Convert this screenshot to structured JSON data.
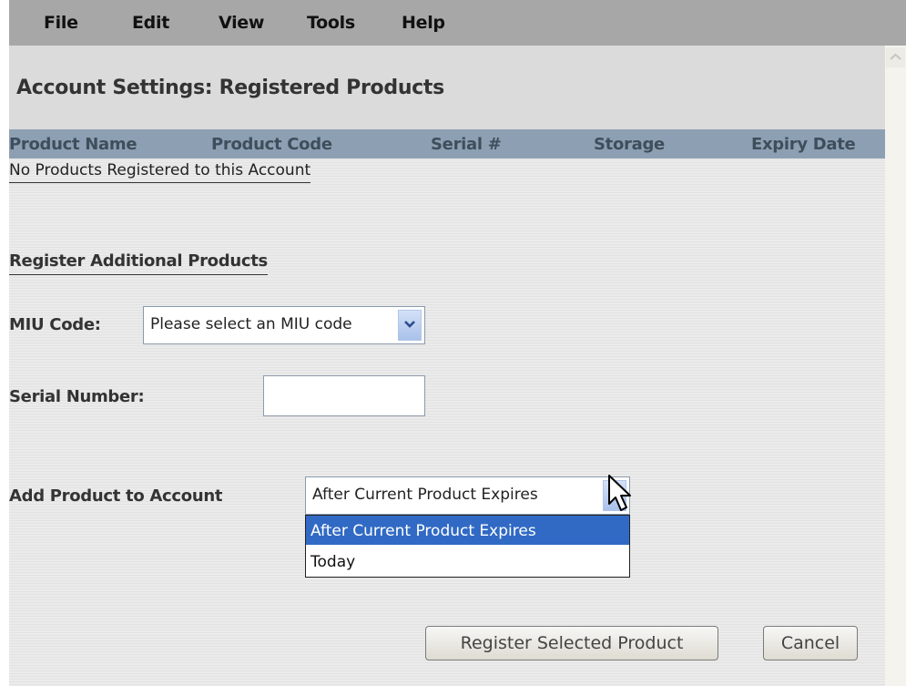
{
  "menu": [
    "File",
    "Edit",
    "View",
    "Tools",
    "Help"
  ],
  "page_title": "Account Settings: Registered Products",
  "table": {
    "columns": [
      "Product Name",
      "Product Code",
      "Serial #",
      "Storage",
      "Expiry Date"
    ],
    "empty_message": "No Products Registered to this Account"
  },
  "register_section": {
    "title": "Register Additional Products",
    "miu_label": "MIU Code:",
    "miu_value": "Please select an MIU code",
    "serial_label": "Serial Number:",
    "serial_value": "",
    "add_label": "Add Product to Account",
    "add_value": "After Current Product Expires",
    "add_options": [
      "After Current Product Expires",
      "Today"
    ],
    "register_button": "Register Selected Product",
    "cancel_button": "Cancel"
  },
  "colors": {
    "menubar": "#a7a7a7",
    "table_header": "#8da0b3",
    "selection": "#316ac5"
  }
}
